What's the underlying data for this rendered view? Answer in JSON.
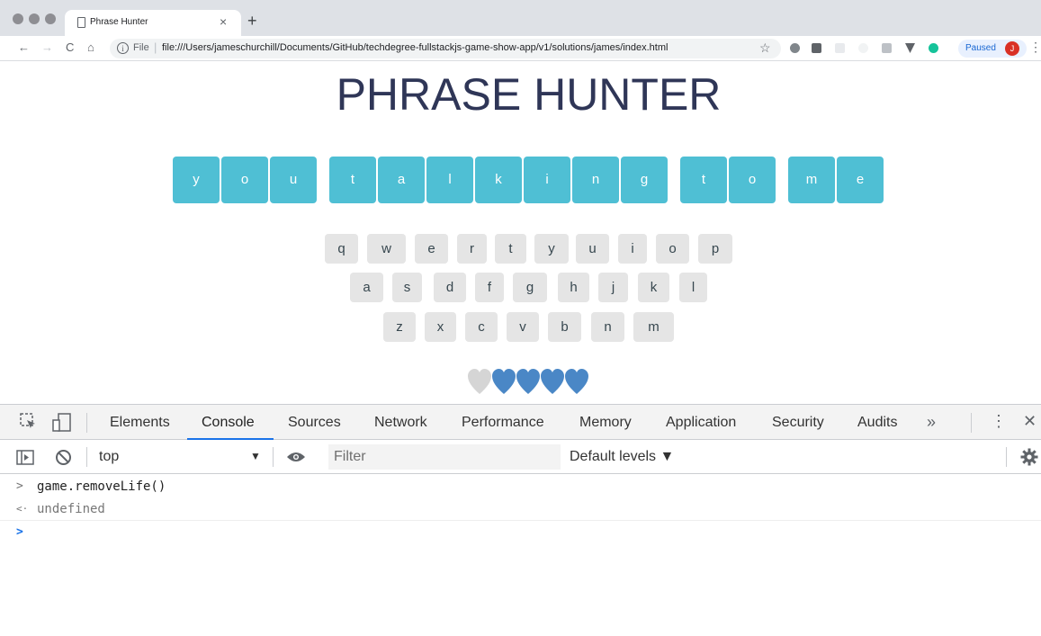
{
  "browser": {
    "tab_title": "Phrase Hunter",
    "tab_close": "×",
    "new_tab": "+",
    "url_scheme": "File",
    "url": "file:///Users/jameschurchill/Documents/GitHub/techdegree-fullstackjs-game-show-app/v1/solutions/james/index.html",
    "paused_label": "Paused",
    "avatar_initial": "J",
    "nav": {
      "back": "←",
      "forward": "→",
      "reload": "C",
      "home": "⌂",
      "star": "☆",
      "menu": "⋮"
    }
  },
  "game": {
    "title": "PHRASE HUNTER",
    "phrase_letters": [
      "y",
      "o",
      "u",
      "t",
      "a",
      "l",
      "k",
      "i",
      "n",
      "g",
      "t",
      "o",
      "m",
      "e"
    ],
    "keyboard_rows": [
      [
        "q",
        "w",
        "e",
        "r",
        "t",
        "y",
        "u",
        "i",
        "o",
        "p"
      ],
      [
        "a",
        "s",
        "d",
        "f",
        "g",
        "h",
        "j",
        "k",
        "l"
      ],
      [
        "z",
        "x",
        "c",
        "v",
        "b",
        "n",
        "m"
      ]
    ],
    "lives": {
      "lost": 1,
      "remaining": 4,
      "total": 5
    },
    "colors": {
      "letter_box": "#4fbfd4",
      "key": "#e5e5e5",
      "heart_live": "#4a87c6",
      "heart_lost": "#d5d5d5",
      "title": "#2f3657"
    }
  },
  "devtools": {
    "tabs": [
      "Elements",
      "Console",
      "Sources",
      "Network",
      "Performance",
      "Memory",
      "Application",
      "Security",
      "Audits"
    ],
    "active_tab": "Console",
    "more_tabs": "»",
    "kebab": "⋮",
    "close": "✕",
    "context": "top",
    "context_arrow": "▼",
    "filter_placeholder": "Filter",
    "levels": "Default levels ▼",
    "console_lines": [
      {
        "prompt": ">",
        "text": "game.removeLife()"
      },
      {
        "prompt": "<·",
        "text": "undefined"
      }
    ],
    "input_prompt": ">"
  }
}
